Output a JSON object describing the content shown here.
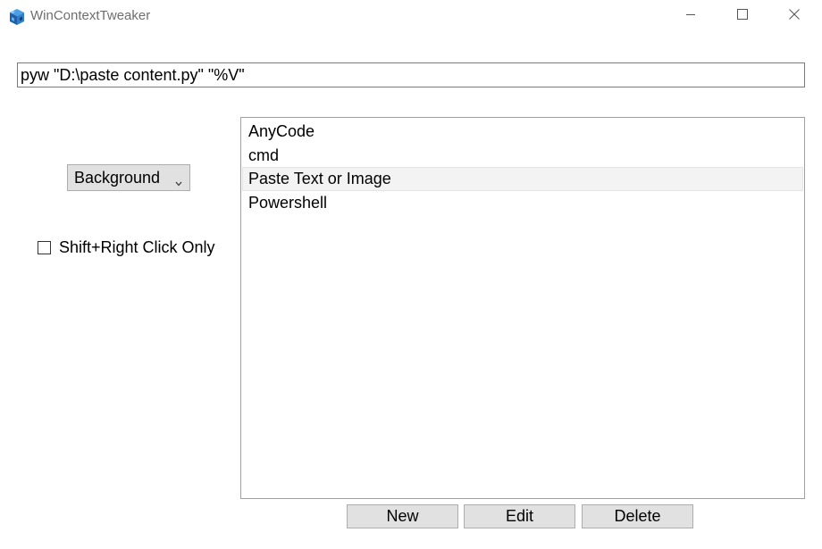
{
  "window": {
    "title": "WinContextTweaker",
    "controls": {
      "minimize": "minimize-icon",
      "maximize": "maximize-icon",
      "close": "close-icon"
    }
  },
  "command": {
    "value": "pyw \"D:\\paste content.py\" \"%V\""
  },
  "mode_select": {
    "selected": "Background"
  },
  "shift_option": {
    "label": "Shift+Right Click Only",
    "checked": false
  },
  "entries": {
    "items": [
      {
        "label": "AnyCode",
        "selected": false
      },
      {
        "label": "cmd",
        "selected": false
      },
      {
        "label": "Paste Text or Image",
        "selected": true
      },
      {
        "label": "Powershell",
        "selected": false
      }
    ]
  },
  "buttons": {
    "new_label": "New",
    "edit_label": "Edit",
    "delete_label": "Delete"
  },
  "colors": {
    "button_face": "#e1e1e1",
    "button_border": "#adadad",
    "selection": "#f3f3f3",
    "title_text": "#6e6e6e"
  }
}
